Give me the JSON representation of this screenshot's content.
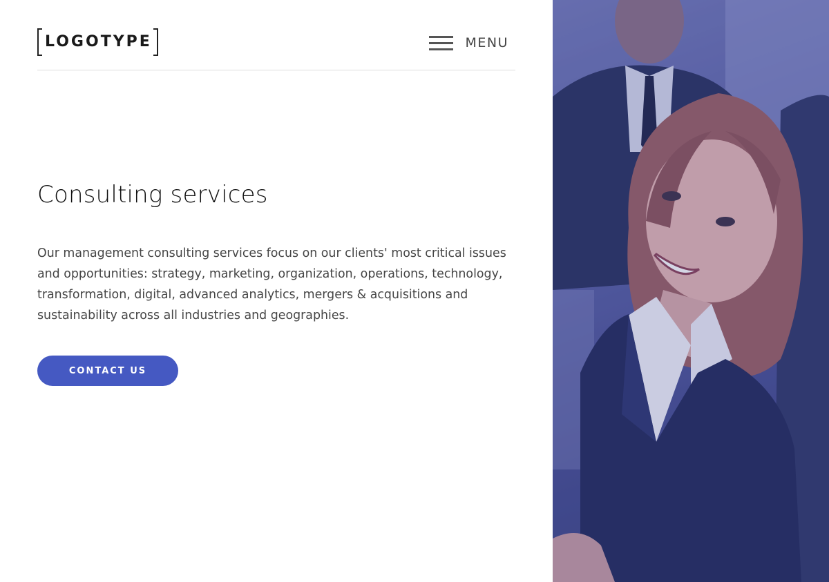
{
  "header": {
    "logo_text": "LOGOTYPE",
    "menu_label": "MENU"
  },
  "hero": {
    "title": "Consulting services",
    "description": "Our management consulting services focus on our clients' most critical issues and opportunities: strategy, marketing, organization, operations, technology, transformation, digital, advanced analytics, mergers & acquisitions and sustainability across all industries and geographies.",
    "cta_label": "CONTACT US"
  },
  "colors": {
    "accent": "#4559c2",
    "photo_tint": "#3c4588"
  },
  "icons": {
    "menu": "hamburger-icon"
  }
}
